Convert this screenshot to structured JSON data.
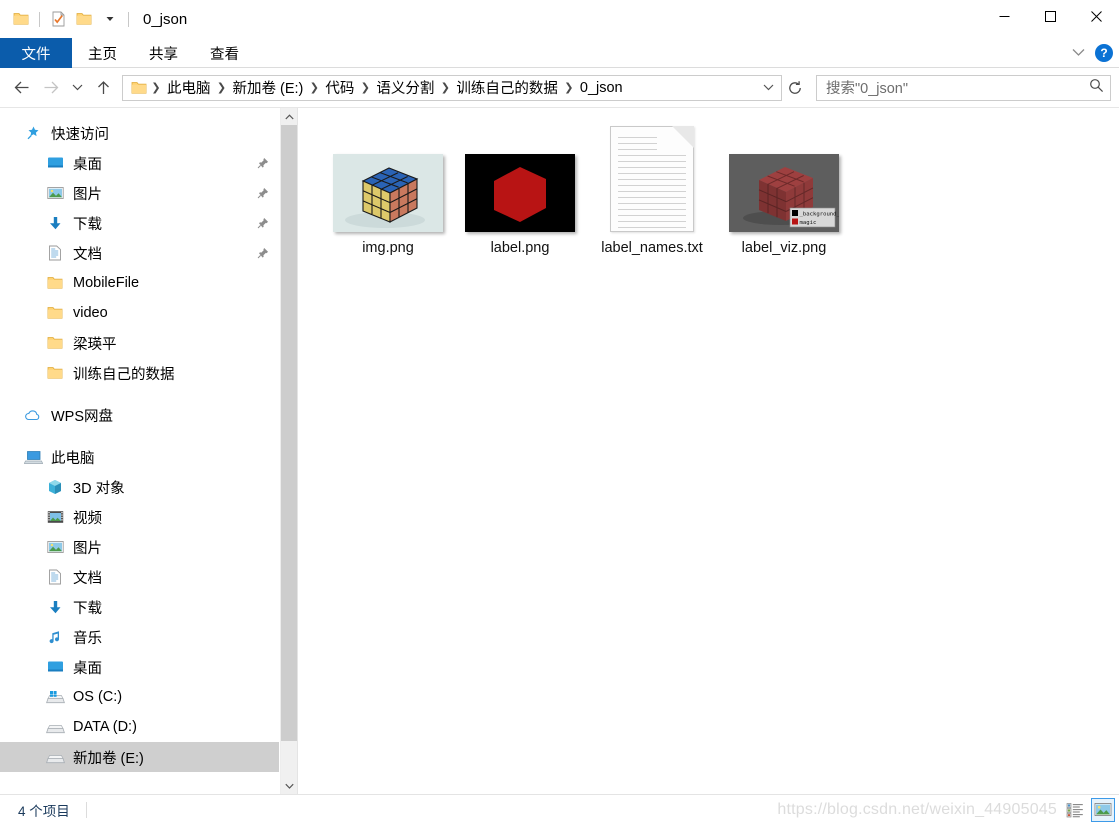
{
  "window": {
    "title": "0_json",
    "quick_access": [
      {
        "name": "folder-icon",
        "label": "文件资源管理器"
      },
      {
        "name": "properties-icon",
        "label": "属性"
      },
      {
        "name": "new-folder-icon",
        "label": "新建文件夹"
      },
      {
        "name": "chevron-down-icon",
        "label": "自定义快速访问工具栏"
      }
    ],
    "controls": {
      "minimize": "—",
      "maximize": "▢",
      "close": "✕",
      "collapse_ribbon": "⌄",
      "help": "?"
    }
  },
  "ribbon": {
    "tabs": [
      {
        "label": "文件",
        "active": true
      },
      {
        "label": "主页",
        "active": false
      },
      {
        "label": "共享",
        "active": false
      },
      {
        "label": "查看",
        "active": false
      }
    ]
  },
  "nav": {
    "back": "←",
    "forward": "→",
    "recent": "⌄",
    "up": "↑",
    "refresh": "↻",
    "breadcrumb": [
      "此电脑",
      "新加卷 (E:)",
      "代码",
      "语义分割",
      "训练自己的数据",
      "0_json"
    ],
    "breadcrumb_separator": "❯",
    "breadcrumb_dropdown": "⌄"
  },
  "search": {
    "placeholder": "搜索\"0_json\"",
    "icon": "search-icon"
  },
  "sidebar": {
    "sections": [
      {
        "header": {
          "label": "快速访问",
          "icon": "star-pin-icon"
        },
        "items": [
          {
            "label": "桌面",
            "icon": "desktop-icon",
            "pinned": true
          },
          {
            "label": "图片",
            "icon": "pictures-icon",
            "pinned": true
          },
          {
            "label": "下载",
            "icon": "downloads-icon",
            "pinned": true
          },
          {
            "label": "文档",
            "icon": "documents-icon",
            "pinned": true
          },
          {
            "label": "MobileFile",
            "icon": "folder-icon",
            "pinned": false
          },
          {
            "label": "video",
            "icon": "folder-icon",
            "pinned": false
          },
          {
            "label": "梁瑛平",
            "icon": "folder-icon",
            "pinned": false
          },
          {
            "label": "训练自己的数据",
            "icon": "folder-icon",
            "pinned": false
          }
        ]
      },
      {
        "header": {
          "label": "WPS网盘",
          "icon": "cloud-icon"
        },
        "items": []
      },
      {
        "header": {
          "label": "此电脑",
          "icon": "this-pc-icon"
        },
        "items": [
          {
            "label": "3D 对象",
            "icon": "3d-objects-icon",
            "pinned": false
          },
          {
            "label": "视频",
            "icon": "videos-icon",
            "pinned": false
          },
          {
            "label": "图片",
            "icon": "pictures-icon",
            "pinned": false
          },
          {
            "label": "文档",
            "icon": "documents-icon",
            "pinned": false
          },
          {
            "label": "下载",
            "icon": "downloads-icon",
            "pinned": false
          },
          {
            "label": "音乐",
            "icon": "music-icon",
            "pinned": false
          },
          {
            "label": "桌面",
            "icon": "desktop-icon",
            "pinned": false
          },
          {
            "label": "OS (C:)",
            "icon": "system-drive-icon",
            "pinned": false
          },
          {
            "label": "DATA (D:)",
            "icon": "drive-icon",
            "pinned": false
          },
          {
            "label": "新加卷 (E:)",
            "icon": "drive-icon",
            "pinned": false,
            "selected": true
          }
        ]
      }
    ],
    "scrollbar": {
      "up": "⌃",
      "down": "⌄"
    }
  },
  "files": [
    {
      "name": "img.png",
      "type": "image-rubiks-cube",
      "thumb": "photo"
    },
    {
      "name": "label.png",
      "type": "image-mask",
      "thumb": "black-mask"
    },
    {
      "name": "label_names.txt",
      "type": "text-file",
      "thumb": "document"
    },
    {
      "name": "label_viz.png",
      "type": "image-visualization",
      "thumb": "viz",
      "legend": [
        {
          "label": "_background_",
          "color": "#000000"
        },
        {
          "label": "magic",
          "color": "#c22222"
        }
      ]
    }
  ],
  "status": {
    "item_count": "4 个项目",
    "watermark": "https://blog.csdn.net/weixin_44905045",
    "views": [
      {
        "name": "details-view",
        "active": false
      },
      {
        "name": "large-icons-view",
        "active": true
      }
    ]
  },
  "colors": {
    "accent": "#0b5cab",
    "selection": "#cfcfcf",
    "hover": "#e9f3fb",
    "folder_yellow": "#ffd271",
    "status_text": "#1b3a5c"
  }
}
